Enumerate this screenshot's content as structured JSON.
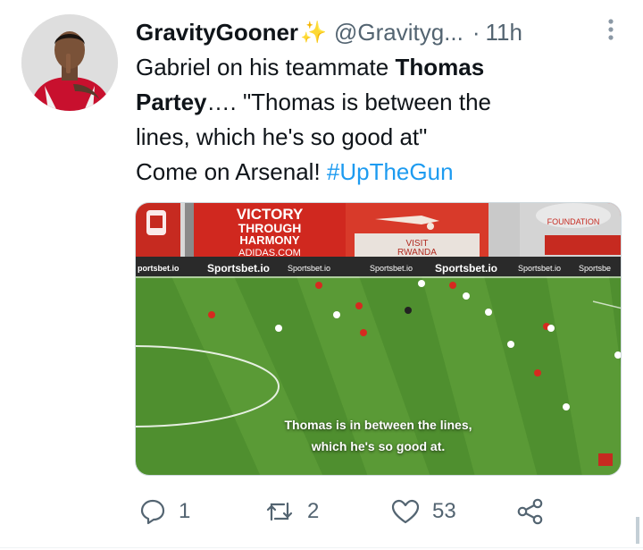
{
  "tweet": {
    "display_name": "GravityGooner",
    "handle": "@Gravityg...",
    "separator": "·",
    "time": "11h",
    "text_line1_intro": "Gabriel on his teammate ",
    "text_line1_bold": "Thomas",
    "text_line2_bold": "Partey",
    "text_line2_rest": "…. \"Thomas is between the",
    "text_line3": "lines, which he's so good at\"",
    "text_line4": "Come on Arsenal! ",
    "hashtag": "#UpTheGun"
  },
  "media": {
    "caption_line1": "Thomas is in between the lines,",
    "caption_line2": "which he's so good at.",
    "banner_victory": "VICTORY",
    "banner_through": "THROUGH",
    "banner_harmony": "HARMONY",
    "banner_adidas": "ADIDAS.COM",
    "banner_visit": "VISIT",
    "banner_rwanda": "RWANDA",
    "banner_foundation": "FOUNDATION",
    "banner_sponsor": "Sportsbet.io",
    "banner_sponsor_left": "portsbet.io",
    "banner_sportsbe": "Sportsbe",
    "banner_s": "S"
  },
  "actions": {
    "reply_count": "1",
    "retweet_count": "2",
    "like_count": "53"
  },
  "icons": {
    "emoji": "sparkles-emoji",
    "reply": "reply-icon",
    "retweet": "retweet-icon",
    "like": "heart-icon",
    "share": "share-icon",
    "more": "more-vertical-icon"
  },
  "colors": {
    "link": "#1d9bf0",
    "secondary_text": "#536471",
    "pitch_green": "#4f8f2f",
    "arsenal_red": "#d62a1f"
  }
}
